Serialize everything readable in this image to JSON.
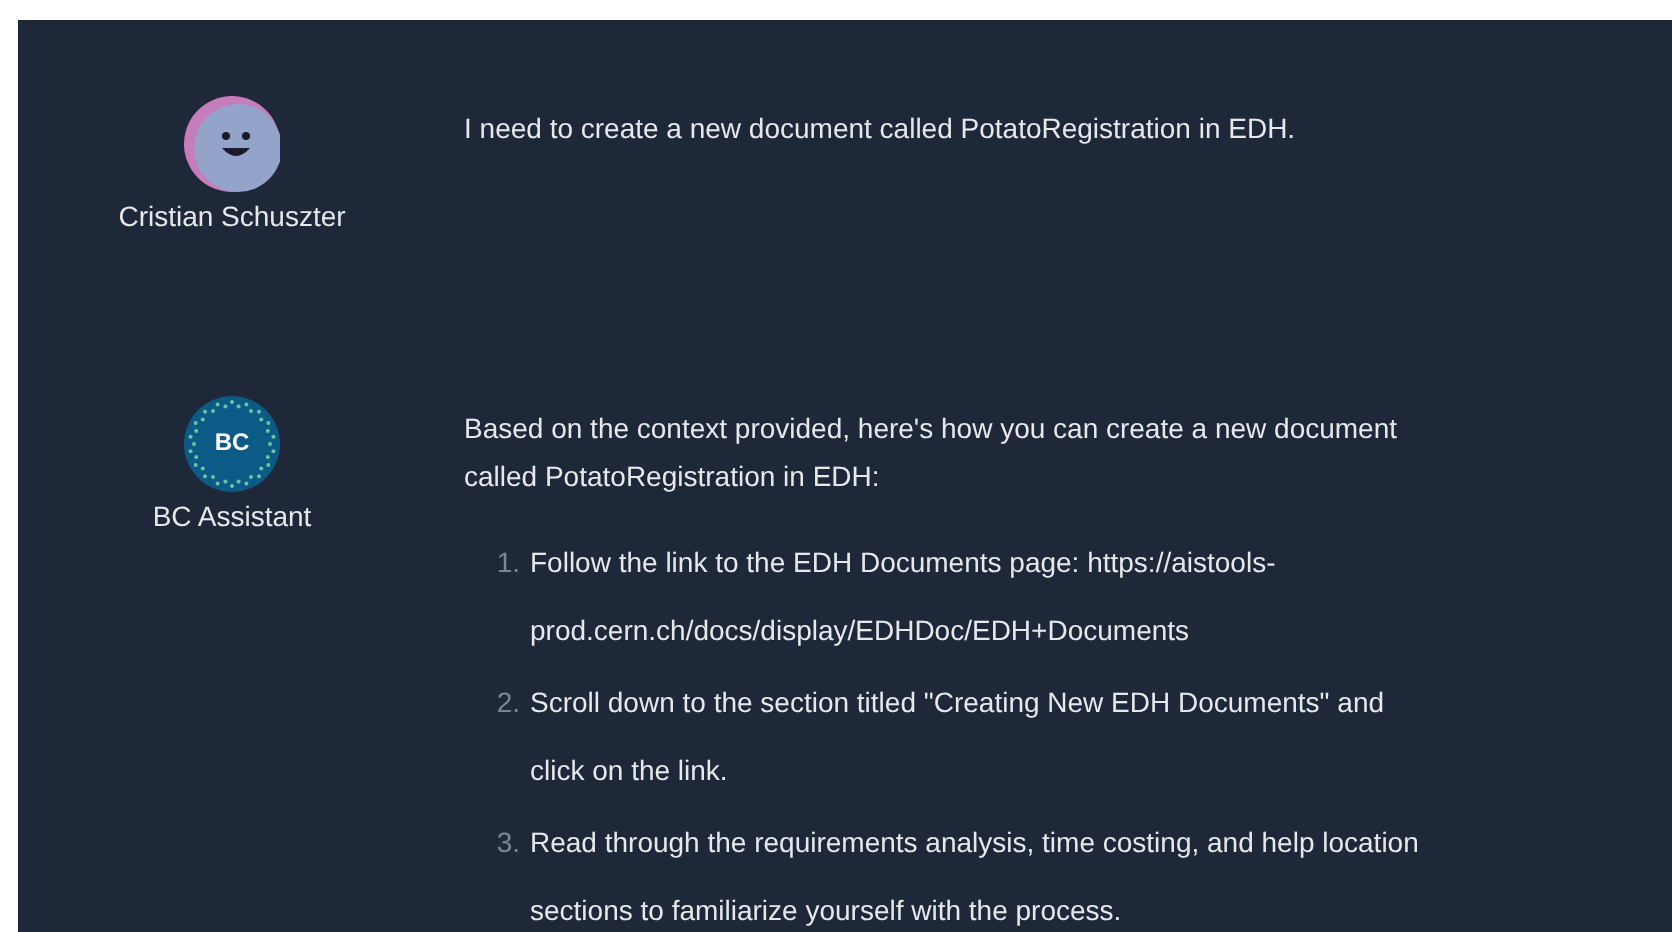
{
  "messages": [
    {
      "author": "Cristian Schuszter",
      "kind": "user",
      "text": "I need to create a new document called PotatoRegistration in EDH."
    },
    {
      "author": "BC Assistant",
      "kind": "assistant",
      "avatar_text": "BC",
      "text": "Based on the context provided, here's how you can create a new document called PotatoRegistration in EDH:",
      "steps": [
        {
          "number": "1.",
          "text": "Follow the link to the EDH Documents page: https://aistools-prod.cern.ch/docs/display/EDHDoc/EDH+Documents"
        },
        {
          "number": "2.",
          "text": "Scroll down to the section titled \"Creating New EDH Documents\" and click on the link."
        },
        {
          "number": "3.",
          "text": "Read through the requirements analysis, time costing, and help location sections to familiarize yourself with the process."
        }
      ]
    }
  ]
}
